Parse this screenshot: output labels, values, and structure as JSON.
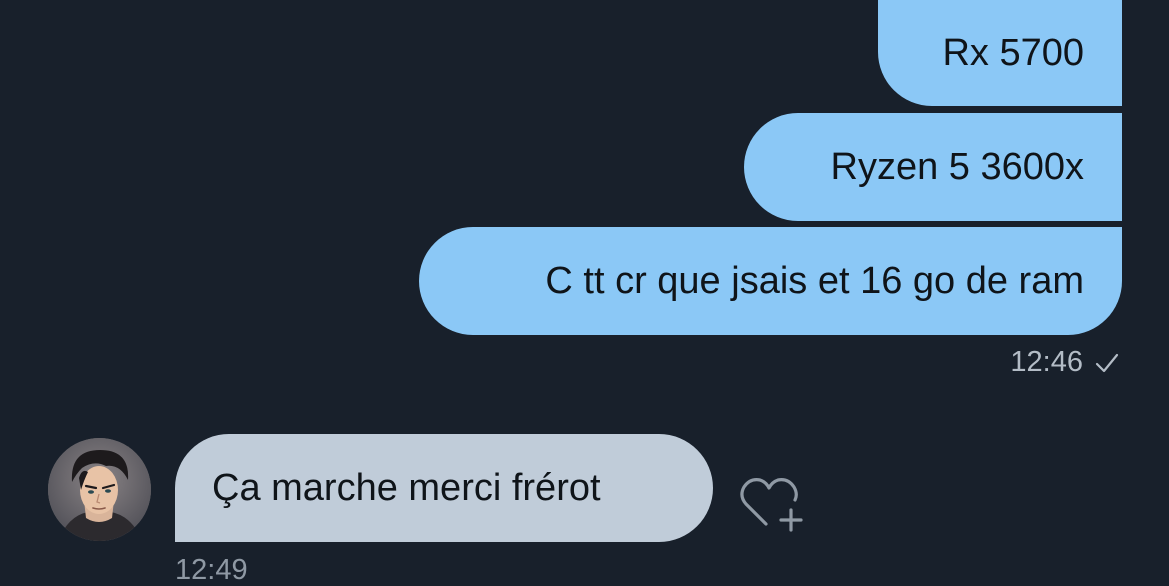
{
  "conversation": {
    "sent_messages": [
      {
        "text": "Rx 5700"
      },
      {
        "text": "Ryzen 5 3600x"
      },
      {
        "text": "C tt cr que jsais et 16 go de ram"
      }
    ],
    "sent_timestamp": "12:46",
    "sent_status_icon": "check-icon",
    "received_message": {
      "text": "Ça marche merci frérot",
      "timestamp": "12:49",
      "avatar_icon": "avatar",
      "reaction_icon": "add-reaction-heart-icon"
    }
  },
  "colors": {
    "background": "#18202b",
    "sent_bubble": "#8bc8f6",
    "received_bubble": "#c0ccd9",
    "timestamp": "#b3bcc6"
  }
}
